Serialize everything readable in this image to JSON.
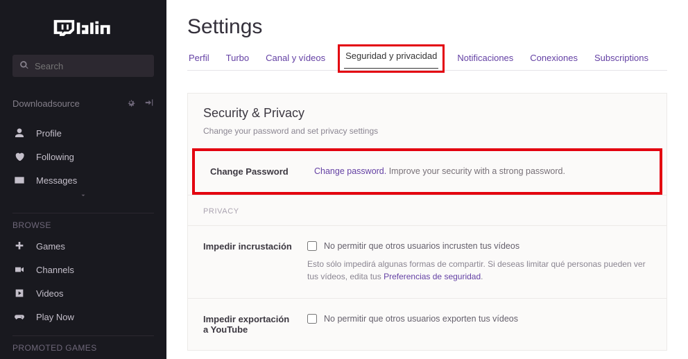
{
  "sidebar": {
    "search_placeholder": "Search",
    "username": "Downloadsource",
    "nav": [
      {
        "label": "Profile"
      },
      {
        "label": "Following"
      },
      {
        "label": "Messages"
      }
    ],
    "browse_heading": "BROWSE",
    "browse": [
      {
        "label": "Games"
      },
      {
        "label": "Channels"
      },
      {
        "label": "Videos"
      },
      {
        "label": "Play Now"
      }
    ],
    "promoted_heading": "PROMOTED GAMES"
  },
  "page": {
    "title": "Settings",
    "tabs": [
      {
        "label": "Perfil"
      },
      {
        "label": "Turbo"
      },
      {
        "label": "Canal y vídeos"
      },
      {
        "label": "Seguridad y privacidad"
      },
      {
        "label": "Notificaciones"
      },
      {
        "label": "Conexiones"
      },
      {
        "label": "Subscriptions"
      }
    ],
    "panel": {
      "title": "Security & Privacy",
      "subtitle": "Change your password and set privacy settings",
      "change_password_label": "Change Password",
      "change_password_link": "Change password.",
      "change_password_text": " Improve your security with a strong password.",
      "privacy_heading": "PRIVACY",
      "embed": {
        "label": "Impedir incrustación",
        "check_text": "No permitir que otros usuarios incrusten tus vídeos",
        "sub1": "Esto sólo impedirá algunas formas de compartir. Si deseas limitar qué personas pueden ver tus vídeos, edita tus ",
        "sub_link": "Preferencias de seguridad",
        "sub2": "."
      },
      "export": {
        "label": "Impedir exportación a YouTube",
        "check_text": "No permitir que otros usuarios exporten tus vídeos"
      }
    }
  }
}
